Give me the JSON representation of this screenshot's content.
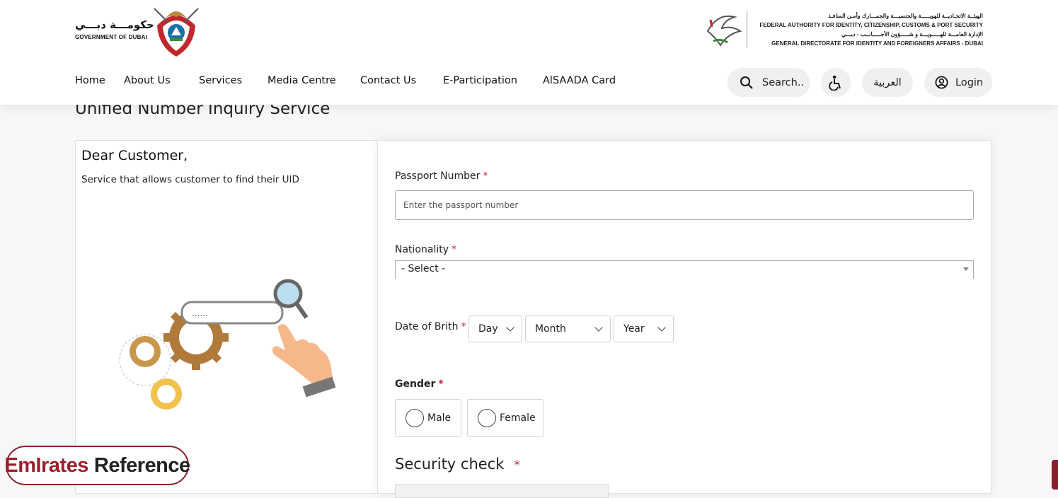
{
  "header": {
    "gov_ar": "حكومـــة دبـــي",
    "gov_en": "GOVERNMENT OF DUBAI",
    "authority_lines": [
      "الهيئــة الاتحـاديــة للهويـــــة والجنسيـــة والجمـــارك وأمـن المنافـذ",
      "FEDERAL AUTHORITY FOR IDENTITY, CITIZENSHIP, CUSTOMS & PORT SECURITY",
      "الإدارة العامـــة للهـــــويـــة و شـــــؤون الأجـــــانــب - دبـــي",
      "GENERAL DIRECTORATE FOR IDENTITY AND FOREIGNERS AFFAIRS - DUBAI"
    ]
  },
  "nav": {
    "items": [
      "Home",
      "About Us",
      "Services",
      "Media Centre",
      "Contact Us",
      "E-Participation",
      "AlSAADA Card"
    ],
    "search_label": "Search..",
    "lang_label": "العربية",
    "login_label": "Login"
  },
  "page": {
    "title": "Unified Number Inquiry Service",
    "greeting": "Dear Customer,",
    "description": "Service that allows customer to find their UID",
    "illustration_text": "......"
  },
  "form": {
    "passport_label": "Passport Number",
    "passport_placeholder": "Enter the passport number",
    "required_mark": "*",
    "nationality_label": "Nationality",
    "nationality_value": "- Select -",
    "dob_label": "Date of Brith",
    "day_label": "Day",
    "month_label": "Month",
    "year_label": "Year",
    "gender_label": "Gender",
    "male_label": "Male",
    "female_label": "Female",
    "security_label": "Security check"
  },
  "watermark": {
    "word1": "EmIrates",
    "word2": "Reference"
  },
  "colors": {
    "accent": "#c1272d",
    "badge": "#8a1f2b"
  }
}
